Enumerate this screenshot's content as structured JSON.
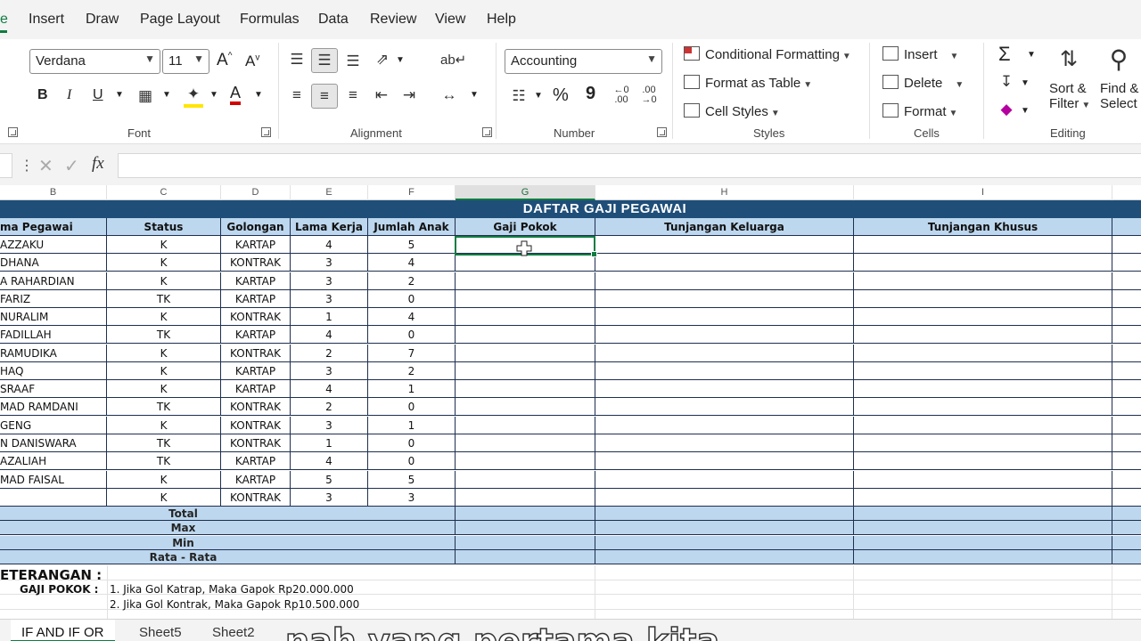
{
  "menu": {
    "tabs": [
      "e",
      "Insert",
      "Draw",
      "Page Layout",
      "Formulas",
      "Data",
      "Review",
      "View",
      "Help"
    ]
  },
  "ribbon": {
    "font": {
      "family": "Verdana",
      "size": "11",
      "group_label": "Font",
      "grow_label": "A",
      "shrink_label": "A",
      "bold": "B",
      "italic": "I",
      "underline": "U",
      "font_color_label": "A"
    },
    "alignment": {
      "group_label": "Alignment"
    },
    "number": {
      "format": "Accounting",
      "group_label": "Number",
      "percent": "%",
      "comma": "9"
    },
    "styles": {
      "conditional": "Conditional Formatting",
      "table": "Format as Table",
      "cell_styles": "Cell Styles",
      "group_label": "Styles"
    },
    "cells": {
      "insert": "Insert",
      "delete": "Delete",
      "format": "Format",
      "group_label": "Cells"
    },
    "editing": {
      "sum": "Σ",
      "sort": "Sort &",
      "sort2": "Filter",
      "find": "Find &",
      "find2": "Select",
      "group_label": "Editing"
    }
  },
  "formula_bar": {
    "fx": "fx",
    "value": ""
  },
  "columns": [
    "B",
    "C",
    "D",
    "E",
    "F",
    "G",
    "H",
    "I"
  ],
  "sheet": {
    "title": "DAFTAR GAJI PEGAWAI",
    "headers": [
      "ma Pegawai",
      "Status",
      "Golongan",
      "Lama Kerja",
      "Jumlah Anak",
      "Gaji Pokok",
      "Tunjangan Keluarga",
      "Tunjangan Khusus"
    ],
    "rows": [
      [
        "AZZAKU",
        "K",
        "KARTAP",
        "4",
        "5"
      ],
      [
        "DHANA",
        "K",
        "KONTRAK",
        "3",
        "4"
      ],
      [
        "A RAHARDIAN",
        "K",
        "KARTAP",
        "3",
        "2"
      ],
      [
        "FARIZ",
        "TK",
        "KARTAP",
        "3",
        "0"
      ],
      [
        " NURALIM",
        "K",
        "KONTRAK",
        "1",
        "4"
      ],
      [
        "FADILLAH",
        "TK",
        "KARTAP",
        "4",
        "0"
      ],
      [
        "RAMUDIKA",
        "K",
        "KONTRAK",
        "2",
        "7"
      ],
      [
        " HAQ",
        "K",
        "KARTAP",
        "3",
        "2"
      ],
      [
        "SRAAF",
        "K",
        "KARTAP",
        "4",
        "1"
      ],
      [
        "MAD RAMDANI",
        "TK",
        "KONTRAK",
        "2",
        "0"
      ],
      [
        "GENG",
        "K",
        "KONTRAK",
        "3",
        "1"
      ],
      [
        "N DANISWARA",
        "TK",
        "KONTRAK",
        "1",
        "0"
      ],
      [
        " AZALIAH",
        "TK",
        "KARTAP",
        "4",
        "0"
      ],
      [
        "MAD FAISAL",
        "K",
        "KARTAP",
        "5",
        "5"
      ],
      [
        "",
        "K",
        "KONTRAK",
        "3",
        "3"
      ]
    ],
    "summary": [
      "Total",
      "Max",
      "Min",
      "Rata - Rata"
    ],
    "keterangan": "ETERANGAN :",
    "gaji_pokok_label": "GAJI POKOK :",
    "note1": "1. Jika Gol Katrap, Maka Gapok Rp20.000.000",
    "note2": "2. Jika Gol Kontrak, Maka Gapok Rp10.500.000"
  },
  "sheet_tabs": [
    "IF AND IF OR",
    "Sheet5",
    "Sheet2"
  ],
  "caption": "nah yang pertama kita"
}
